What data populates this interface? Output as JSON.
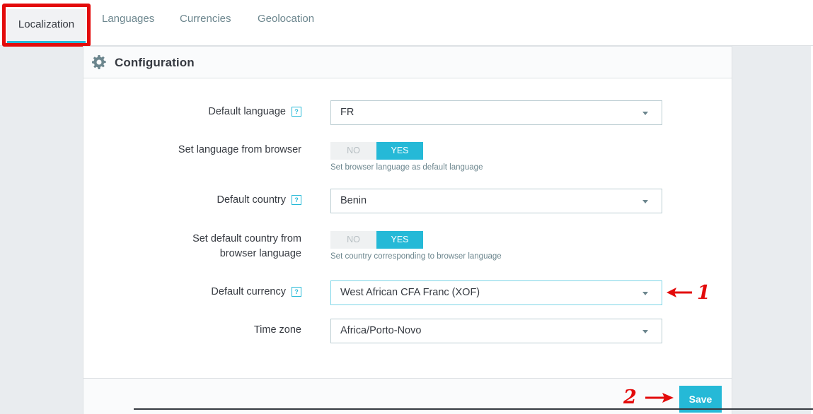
{
  "tabs": [
    {
      "label": "Localization",
      "active": true
    },
    {
      "label": "Languages",
      "active": false
    },
    {
      "label": "Currencies",
      "active": false
    },
    {
      "label": "Geolocation",
      "active": false
    }
  ],
  "card": {
    "title": "Configuration",
    "icon": "gear-icon"
  },
  "form": {
    "default_language": {
      "label": "Default language",
      "help": "?",
      "value": "FR"
    },
    "language_from_browser": {
      "label": "Set language from browser",
      "no": "NO",
      "yes": "YES",
      "selected": "YES",
      "help_text": "Set browser language as default language"
    },
    "default_country": {
      "label": "Default country",
      "help": "?",
      "value": "Benin"
    },
    "country_from_browser": {
      "label_line1": "Set default country from",
      "label_line2": "browser language",
      "no": "NO",
      "yes": "YES",
      "selected": "YES",
      "help_text": "Set country corresponding to browser language"
    },
    "default_currency": {
      "label": "Default currency",
      "help": "?",
      "value": "West African CFA Franc (XOF)"
    },
    "time_zone": {
      "label": "Time zone",
      "value": "Africa/Porto-Novo"
    }
  },
  "footer": {
    "save_label": "Save"
  },
  "annotations": {
    "marker_1": "1",
    "marker_2": "2",
    "color": "#e30b0b"
  },
  "colors": {
    "accent": "#25b9d7",
    "annotation_red": "#e30b0b"
  }
}
